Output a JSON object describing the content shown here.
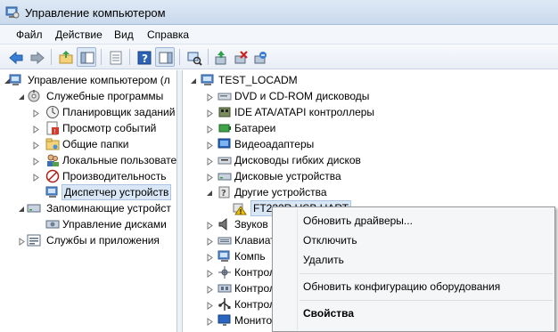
{
  "window": {
    "title": "Управление компьютером"
  },
  "menu": [
    "Файл",
    "Действие",
    "Вид",
    "Справка"
  ],
  "toolbar": {
    "icons": [
      "back-arrow-icon",
      "forward-arrow-icon",
      "up-folder-icon",
      "show-hide-tree-icon",
      "export-list-icon",
      "help-icon",
      "action-pane-icon",
      "scan-hardware-icon",
      "update-driver-icon",
      "disable-device-icon",
      "uninstall-device-icon"
    ]
  },
  "left_tree": [
    {
      "label": "Управление компьютером (л",
      "icon": "computer-management-icon"
    },
    {
      "label": "Служебные программы",
      "icon": "tools-icon"
    },
    {
      "label": "Планировщик заданий",
      "icon": "clock-icon"
    },
    {
      "label": "Просмотр событий",
      "icon": "event-viewer-icon"
    },
    {
      "label": "Общие папки",
      "icon": "shared-folder-icon"
    },
    {
      "label": "Локальные пользовате",
      "icon": "users-icon"
    },
    {
      "label": "Производительность",
      "icon": "performance-icon"
    },
    {
      "label": "Диспетчер устройств",
      "icon": "device-manager-icon"
    },
    {
      "label": "Запоминающие устройст",
      "icon": "storage-icon"
    },
    {
      "label": "Управление дисками",
      "icon": "disk-management-icon"
    },
    {
      "label": "Службы и приложения",
      "icon": "services-icon"
    }
  ],
  "right_tree": {
    "root": "TEST_LOCADM",
    "items": [
      "DVD и CD-ROM дисководы",
      "IDE ATA/ATAPI контроллеры",
      "Батареи",
      "Видеоадаптеры",
      "Дисководы гибких дисков",
      "Дисковые устройства",
      "Другие устройства",
      "FT232R USB UART",
      "Звуков",
      "Клавиат",
      "Компь",
      "Контрол",
      "Контрол",
      "Контрол",
      "Монитор"
    ]
  },
  "context_menu": {
    "update_drivers": "Обновить драйверы...",
    "disable": "Отключить",
    "uninstall": "Удалить",
    "scan_hardware": "Обновить конфигурацию оборудования",
    "properties": "Свойства"
  },
  "colors": {
    "accent": "#1e6fc1",
    "warning": "#f2c200",
    "selection": "#d9e6f5"
  }
}
